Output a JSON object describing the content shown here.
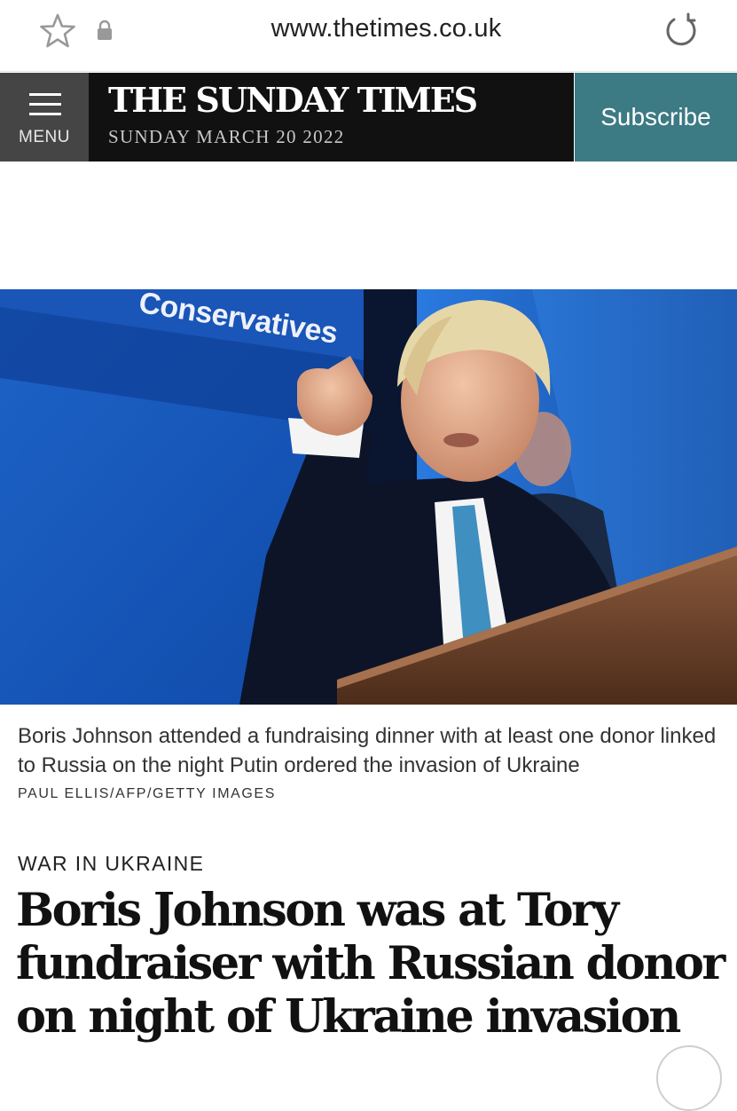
{
  "browser": {
    "url": "www.thetimes.co.uk",
    "icons": [
      "star-icon",
      "lock-icon",
      "reload-icon"
    ]
  },
  "header": {
    "menu_label": "MENU",
    "brand_title": "THE SUNDAY TIMES",
    "brand_date": "SUNDAY MARCH 20 2022",
    "subscribe_label": "Subscribe",
    "colors": {
      "menu_bg": "#454545",
      "brand_bg": "#111111",
      "subscribe_bg": "#3c7a84"
    }
  },
  "article": {
    "photo_banner_text": "Conservatives",
    "caption": "Boris Johnson attended a fundraising dinner with at least one donor linked to Russia on the night Putin ordered the invasion of Ukraine",
    "credit": "PAUL ELLIS/AFP/GETTY IMAGES",
    "section": "WAR IN UKRAINE",
    "headline": "Boris Johnson was at Tory fundraiser with Russian donor on night of Ukraine invasion"
  }
}
